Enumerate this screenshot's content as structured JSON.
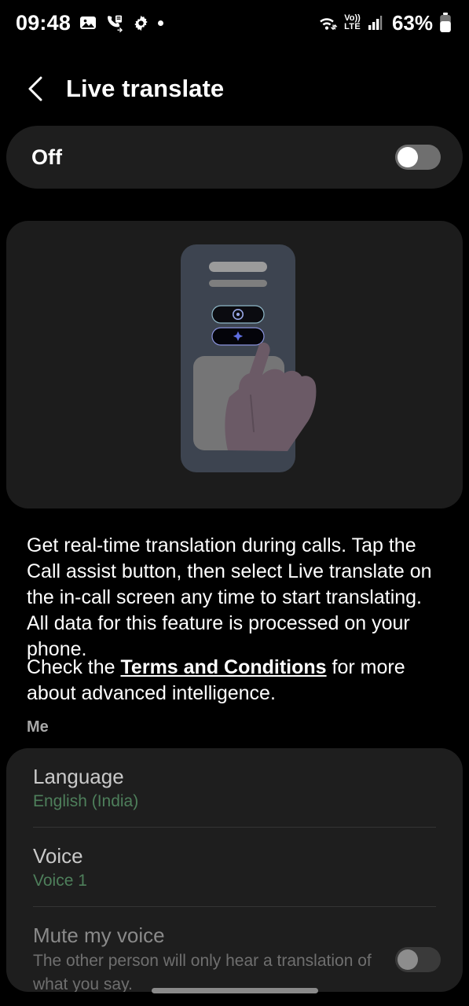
{
  "status_bar": {
    "time": "09:48",
    "left_icons": [
      "image-icon",
      "call-log-icon",
      "gear-icon",
      "dot-icon"
    ],
    "right_icons": [
      "wifi-icon",
      "volte-icon",
      "signal-icon"
    ],
    "volte_top": "Vo))",
    "volte_bottom": "LTE",
    "battery_percent": "63%"
  },
  "header": {
    "back_icon": "chevron-left-icon",
    "title": "Live translate"
  },
  "master_toggle": {
    "label": "Off",
    "state": "off"
  },
  "illustration": {
    "name": "live-translate-tap-illustration",
    "phone_color": "#3d4450",
    "screen_color": "#7a7a7a",
    "hand_color": "#6b5a66",
    "pill_glow_color": "#7f8fd8"
  },
  "description": {
    "paragraph_1": "Get real-time translation during calls. Tap the Call assist button, then select Live translate on the in-call screen any time to start translating. All data for this feature is processed on your phone.",
    "paragraph_2_before": "Check the ",
    "paragraph_2_link": "Terms and Conditions",
    "paragraph_2_after": " for more about advanced intelligence."
  },
  "section": {
    "header": "Me"
  },
  "settings": {
    "rows": [
      {
        "title": "Language",
        "value": "English (India)",
        "value_color": "#4e7f5b",
        "type": "value-row"
      },
      {
        "title": "Voice",
        "value": "Voice 1",
        "value_color": "#4e7f5b",
        "type": "value-row"
      },
      {
        "title": "Mute my voice",
        "value": "The other person will only hear a translation of what you say.",
        "type": "switch-row",
        "switch_state": "off",
        "disabled": true
      }
    ]
  },
  "navigation": {
    "gesture_bar": "home-gesture-bar"
  },
  "colors": {
    "background": "#000000",
    "card": "#1e1e1e",
    "illustration_card": "#1c1c1c",
    "accent_green": "#4e7f5b",
    "primary_text": "#ffffff",
    "secondary_text": "#c9c9c9",
    "muted_text": "#6f6f6f"
  }
}
